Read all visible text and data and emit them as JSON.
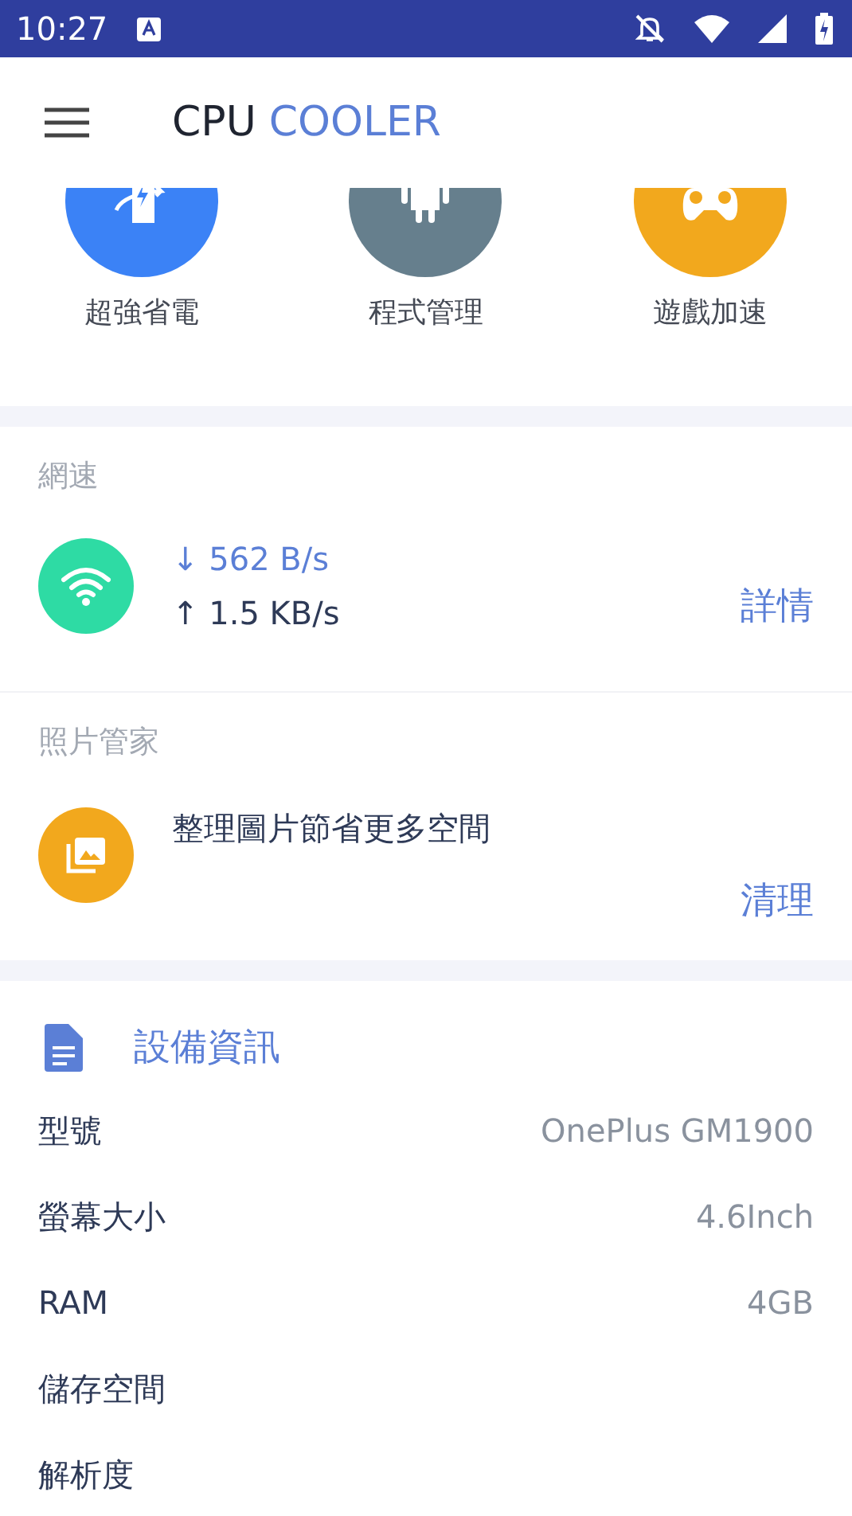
{
  "status_bar": {
    "time": "10:27"
  },
  "app_bar": {
    "title": "CPU",
    "title_accent": "COOLER"
  },
  "shortcuts": [
    {
      "label": "超強省電",
      "color": "#3b82f6",
      "kind": "power"
    },
    {
      "label": "程式管理",
      "color": "#667f8d",
      "kind": "android"
    },
    {
      "label": "遊戲加速",
      "color": "#f2a81d",
      "kind": "game"
    }
  ],
  "network": {
    "title": "網速",
    "download": "↓ 562 B/s",
    "upload": "↑ 1.5 KB/s",
    "action": "詳情"
  },
  "photos": {
    "title": "照片管家",
    "message": "整理圖片節省更多空間",
    "action": "清理"
  },
  "device_info": {
    "title": "設備資訊",
    "rows": [
      {
        "label": "型號",
        "value": "OnePlus GM1900"
      },
      {
        "label": "螢幕大小",
        "value": "4.6Inch"
      },
      {
        "label": "RAM",
        "value": "4GB"
      },
      {
        "label": "儲存空間"
      },
      {
        "label": "解析度"
      }
    ]
  }
}
